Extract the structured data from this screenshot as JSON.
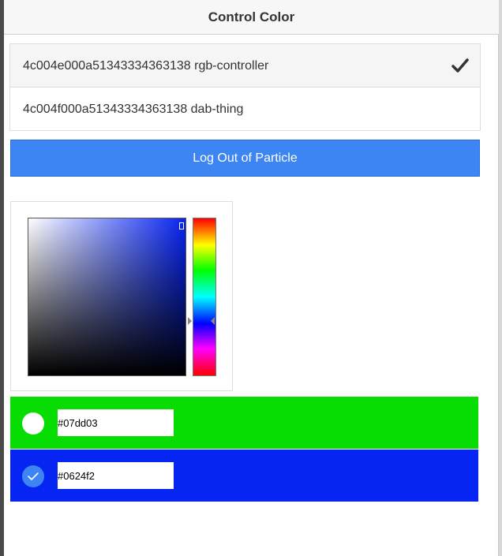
{
  "header": {
    "title": "Control Color"
  },
  "devices": [
    {
      "label": "4c004e000a51343334363138 rgb-controller",
      "selected": true
    },
    {
      "label": "4c004f000a51343334363138 dab-thing",
      "selected": false
    }
  ],
  "logout": {
    "label": "Log Out of Particle"
  },
  "picker": {
    "color": "#0624f2",
    "hue_icon": "hue-slider",
    "sv_icon": "saturation-value-field"
  },
  "swatches": [
    {
      "hex": "#07dd03",
      "color": "#07dd03",
      "checked": false
    },
    {
      "hex": "#0624f2",
      "color": "#0624f2",
      "checked": true
    }
  ],
  "colors": {
    "accent": "#3c85f3",
    "header_bg": "#f7f7f7"
  }
}
